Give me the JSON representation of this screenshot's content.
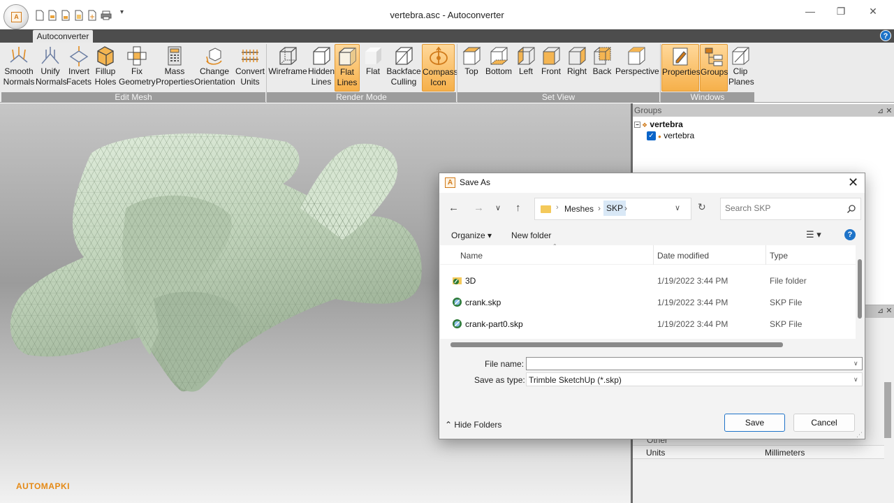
{
  "window": {
    "title": "vertebra.asc - Autoconverter",
    "orb_letter": "A",
    "minimize": "—",
    "maximize": "❐",
    "close": "✕",
    "qa_more": "▾"
  },
  "tabs": {
    "active": "Autoconverter"
  },
  "help_glyph": "?",
  "ribbon": {
    "groups": [
      {
        "label": "Edit Mesh",
        "buttons": [
          {
            "line1": "Smooth",
            "line2": "Normals",
            "icon": "smooth-normals-icon"
          },
          {
            "line1": "Unify",
            "line2": "Normals",
            "icon": "unify-normals-icon"
          },
          {
            "line1": "Invert",
            "line2": "Facets",
            "icon": "invert-facets-icon"
          },
          {
            "line1": "Fillup",
            "line2": "Holes",
            "icon": "fillup-holes-icon"
          },
          {
            "line1": "Fix",
            "line2": "Geometry",
            "icon": "fix-geometry-icon"
          },
          {
            "line1": "Mass",
            "line2": "Properties",
            "icon": "calculator-icon"
          },
          {
            "line1": "Change",
            "line2": "Orientation",
            "icon": "change-orientation-icon"
          },
          {
            "line1": "Convert",
            "line2": "Units",
            "icon": "ruler-icon"
          }
        ]
      },
      {
        "label": "Render Mode",
        "buttons": [
          {
            "line1": "Wireframe",
            "line2": "",
            "icon": "wireframe-cube-icon"
          },
          {
            "line1": "Hidden",
            "line2": "Lines",
            "icon": "hidden-lines-cube-icon"
          },
          {
            "line1": "Flat",
            "line2": "Lines",
            "icon": "flat-lines-cube-icon",
            "active": true
          },
          {
            "line1": "Flat",
            "line2": "",
            "icon": "flat-cube-icon"
          },
          {
            "line1": "Backface",
            "line2": "Culling",
            "icon": "backface-culling-icon"
          },
          {
            "line1": "Compass",
            "line2": "Icon",
            "icon": "compass-icon",
            "active": true
          }
        ]
      },
      {
        "label": "Set View",
        "buttons": [
          {
            "line1": "Top",
            "line2": "",
            "icon": "top-view-icon"
          },
          {
            "line1": "Bottom",
            "line2": "",
            "icon": "bottom-view-icon"
          },
          {
            "line1": "Left",
            "line2": "",
            "icon": "left-view-icon"
          },
          {
            "line1": "Front",
            "line2": "",
            "icon": "front-view-icon"
          },
          {
            "line1": "Right",
            "line2": "",
            "icon": "right-view-icon"
          },
          {
            "line1": "Back",
            "line2": "",
            "icon": "back-view-icon"
          },
          {
            "line1": "Perspective",
            "line2": "",
            "icon": "perspective-view-icon"
          }
        ]
      },
      {
        "label": "Windows",
        "buttons": [
          {
            "line1": "Properties",
            "line2": "",
            "icon": "properties-icon",
            "active": true
          },
          {
            "line1": "Groups",
            "line2": "",
            "icon": "groups-icon",
            "active": true
          },
          {
            "line1": "Clip",
            "line2": "Planes",
            "icon": "clip-planes-icon"
          }
        ]
      }
    ]
  },
  "brand": "AUTOMAPKI",
  "groups_panel": {
    "title": "Groups",
    "pin": "⊿ ✕",
    "root": "vertebra",
    "child": "vertebra"
  },
  "props_panel": {
    "pin": "⊿ ✕",
    "other": "Other",
    "units_label": "Units",
    "units_value": "Millimeters"
  },
  "dialog": {
    "title": "Save As",
    "close": "✕",
    "path": [
      "Meshes",
      "SKP"
    ],
    "search_placeholder": "Search SKP",
    "organize": "Organize ▾",
    "new_folder": "New folder",
    "view_glyph": "☰ ▾",
    "help": "?",
    "columns": {
      "name": "Name",
      "date": "Date modified",
      "type": "Type"
    },
    "files": [
      {
        "name": "3D",
        "date": "1/19/2022 3:44 PM",
        "type": "File folder"
      },
      {
        "name": "crank.skp",
        "date": "1/19/2022 3:44 PM",
        "type": "SKP File"
      },
      {
        "name": "crank-part0.skp",
        "date": "1/19/2022 3:44 PM",
        "type": "SKP File"
      }
    ],
    "file_name_label": "File name:",
    "file_name_value": "",
    "save_type_label": "Save as type:",
    "save_type_value": "Trimble SketchUp (*.skp)",
    "hide_folders": "⌃ Hide Folders",
    "save": "Save",
    "cancel": "Cancel"
  },
  "colors": {
    "accent": "#f6b04a",
    "mesh": "#c9dcc3",
    "brand": "#e58a16",
    "link_blue": "#1e73c8"
  }
}
